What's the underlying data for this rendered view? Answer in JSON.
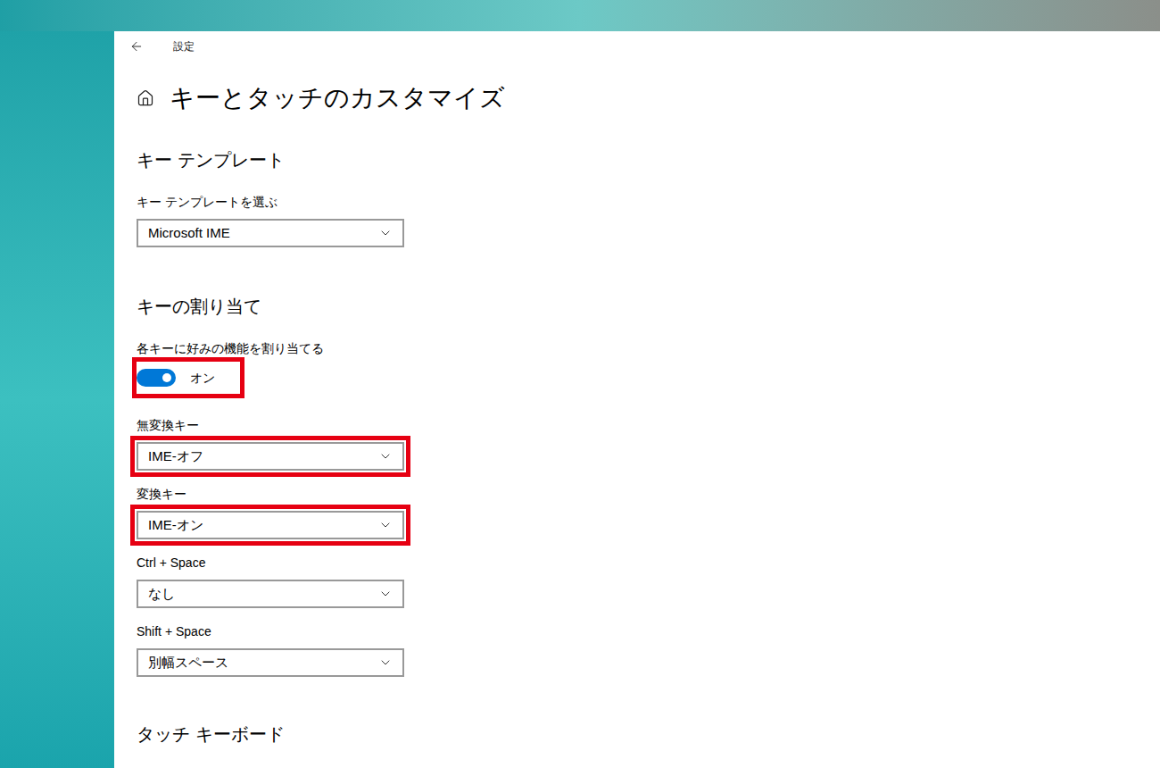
{
  "window": {
    "title": "設定"
  },
  "page": {
    "title": "キーとタッチのカスタマイズ"
  },
  "key_template": {
    "heading": "キー テンプレート",
    "label": "キー テンプレートを選ぶ",
    "value": "Microsoft IME"
  },
  "key_assignment": {
    "heading": "キーの割り当て",
    "toggle": {
      "label": "各キーに好みの機能を割り当てる",
      "on": true,
      "state_text": "オン",
      "highlighted": true
    },
    "dropdowns": [
      {
        "label": "無変換キー",
        "value": "IME-オフ",
        "highlighted": true
      },
      {
        "label": "変換キー",
        "value": "IME-オン",
        "highlighted": true
      },
      {
        "label": "Ctrl + Space",
        "value": "なし",
        "highlighted": false
      },
      {
        "label": "Shift + Space",
        "value": "別幅スペース",
        "highlighted": false
      }
    ]
  },
  "touch_keyboard": {
    "heading": "タッチ キーボード"
  }
}
